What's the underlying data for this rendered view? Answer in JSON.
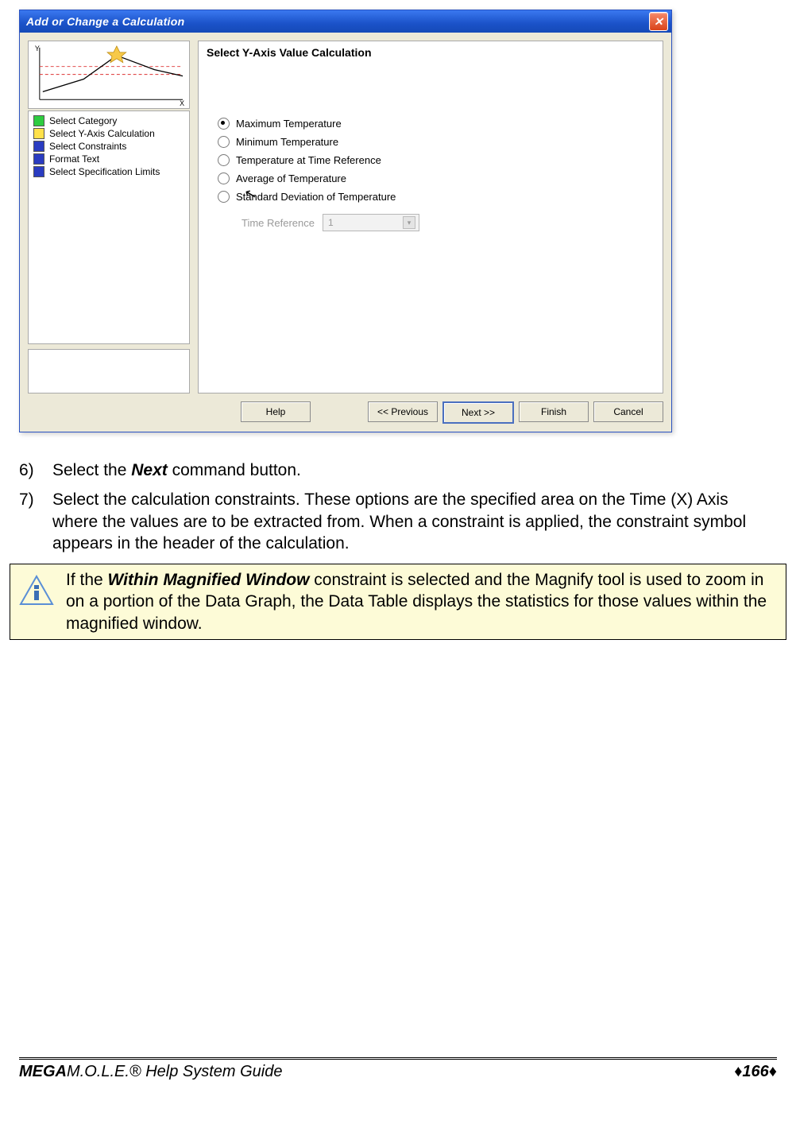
{
  "dialog": {
    "title": "Add or Change a Calculation",
    "right_panel_title": "Select Y-Axis Value Calculation",
    "steps": [
      {
        "color": "#2ecc40",
        "label": "Select Category"
      },
      {
        "color": "#ffe14a",
        "label": "Select Y-Axis Calculation"
      },
      {
        "color": "#2a3cc1",
        "label": "Select Constraints"
      },
      {
        "color": "#2a3cc1",
        "label": "Format Text"
      },
      {
        "color": "#2a3cc1",
        "label": "Select Specification Limits"
      }
    ],
    "radios": {
      "selected_index": 0,
      "options": [
        "Maximum Temperature",
        "Minimum Temperature",
        "Temperature at Time Reference",
        "Average of Temperature",
        "Standard Deviation of Temperature"
      ]
    },
    "time_ref_label": "Time Reference",
    "time_ref_value": "1",
    "buttons": {
      "help": "Help",
      "prev": "<< Previous",
      "next": "Next >>",
      "finish": "Finish",
      "cancel": "Cancel"
    }
  },
  "doc": {
    "item6_num": "6)",
    "item6_text_pre": "Select the ",
    "item6_bold": "Next",
    "item6_text_post": " command button.",
    "item7_num": "7)",
    "item7_text": "Select the calculation constraints. These options are the specified area on the Time (X) Axis where the values are to be extracted from. When a constraint is applied, the constraint symbol appears in the header of the calculation.",
    "note_pre": "If the ",
    "note_bold": "Within Magnified Window",
    "note_post": " constraint is selected and the Magnify tool is used to zoom in on a portion of the Data Graph, the Data Table displays the statistics for those values within the magnified window."
  },
  "footer": {
    "title_bold": "MEGA",
    "title_rest": "M.O.L.E.® Help System Guide",
    "page": "166"
  }
}
